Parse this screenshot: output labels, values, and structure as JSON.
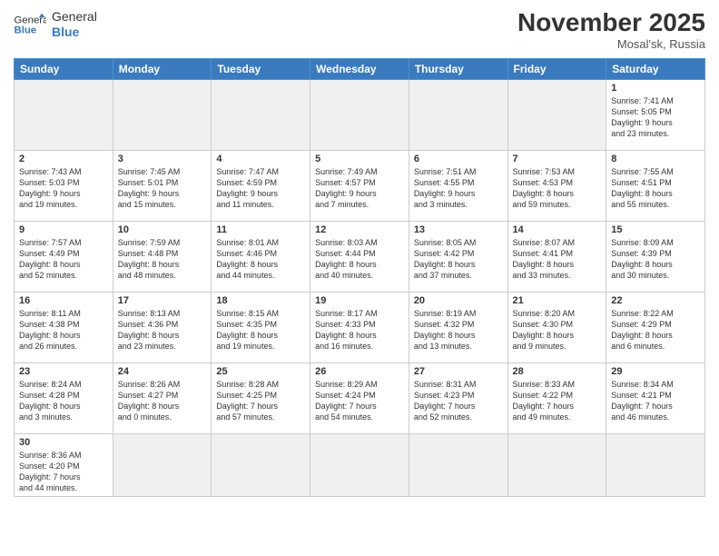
{
  "header": {
    "logo_general": "General",
    "logo_blue": "Blue",
    "month_title": "November 2025",
    "location": "Mosal'sk, Russia"
  },
  "weekdays": [
    "Sunday",
    "Monday",
    "Tuesday",
    "Wednesday",
    "Thursday",
    "Friday",
    "Saturday"
  ],
  "weeks": [
    [
      {
        "day": "",
        "info": "",
        "empty": true
      },
      {
        "day": "",
        "info": "",
        "empty": true
      },
      {
        "day": "",
        "info": "",
        "empty": true
      },
      {
        "day": "",
        "info": "",
        "empty": true
      },
      {
        "day": "",
        "info": "",
        "empty": true
      },
      {
        "day": "",
        "info": "",
        "empty": true
      },
      {
        "day": "1",
        "info": "Sunrise: 7:41 AM\nSunset: 5:05 PM\nDaylight: 9 hours\nand 23 minutes."
      }
    ],
    [
      {
        "day": "2",
        "info": "Sunrise: 7:43 AM\nSunset: 5:03 PM\nDaylight: 9 hours\nand 19 minutes."
      },
      {
        "day": "3",
        "info": "Sunrise: 7:45 AM\nSunset: 5:01 PM\nDaylight: 9 hours\nand 15 minutes."
      },
      {
        "day": "4",
        "info": "Sunrise: 7:47 AM\nSunset: 4:59 PM\nDaylight: 9 hours\nand 11 minutes."
      },
      {
        "day": "5",
        "info": "Sunrise: 7:49 AM\nSunset: 4:57 PM\nDaylight: 9 hours\nand 7 minutes."
      },
      {
        "day": "6",
        "info": "Sunrise: 7:51 AM\nSunset: 4:55 PM\nDaylight: 9 hours\nand 3 minutes."
      },
      {
        "day": "7",
        "info": "Sunrise: 7:53 AM\nSunset: 4:53 PM\nDaylight: 8 hours\nand 59 minutes."
      },
      {
        "day": "8",
        "info": "Sunrise: 7:55 AM\nSunset: 4:51 PM\nDaylight: 8 hours\nand 55 minutes."
      }
    ],
    [
      {
        "day": "9",
        "info": "Sunrise: 7:57 AM\nSunset: 4:49 PM\nDaylight: 8 hours\nand 52 minutes."
      },
      {
        "day": "10",
        "info": "Sunrise: 7:59 AM\nSunset: 4:48 PM\nDaylight: 8 hours\nand 48 minutes."
      },
      {
        "day": "11",
        "info": "Sunrise: 8:01 AM\nSunset: 4:46 PM\nDaylight: 8 hours\nand 44 minutes."
      },
      {
        "day": "12",
        "info": "Sunrise: 8:03 AM\nSunset: 4:44 PM\nDaylight: 8 hours\nand 40 minutes."
      },
      {
        "day": "13",
        "info": "Sunrise: 8:05 AM\nSunset: 4:42 PM\nDaylight: 8 hours\nand 37 minutes."
      },
      {
        "day": "14",
        "info": "Sunrise: 8:07 AM\nSunset: 4:41 PM\nDaylight: 8 hours\nand 33 minutes."
      },
      {
        "day": "15",
        "info": "Sunrise: 8:09 AM\nSunset: 4:39 PM\nDaylight: 8 hours\nand 30 minutes."
      }
    ],
    [
      {
        "day": "16",
        "info": "Sunrise: 8:11 AM\nSunset: 4:38 PM\nDaylight: 8 hours\nand 26 minutes."
      },
      {
        "day": "17",
        "info": "Sunrise: 8:13 AM\nSunset: 4:36 PM\nDaylight: 8 hours\nand 23 minutes."
      },
      {
        "day": "18",
        "info": "Sunrise: 8:15 AM\nSunset: 4:35 PM\nDaylight: 8 hours\nand 19 minutes."
      },
      {
        "day": "19",
        "info": "Sunrise: 8:17 AM\nSunset: 4:33 PM\nDaylight: 8 hours\nand 16 minutes."
      },
      {
        "day": "20",
        "info": "Sunrise: 8:19 AM\nSunset: 4:32 PM\nDaylight: 8 hours\nand 13 minutes."
      },
      {
        "day": "21",
        "info": "Sunrise: 8:20 AM\nSunset: 4:30 PM\nDaylight: 8 hours\nand 9 minutes."
      },
      {
        "day": "22",
        "info": "Sunrise: 8:22 AM\nSunset: 4:29 PM\nDaylight: 8 hours\nand 6 minutes."
      }
    ],
    [
      {
        "day": "23",
        "info": "Sunrise: 8:24 AM\nSunset: 4:28 PM\nDaylight: 8 hours\nand 3 minutes."
      },
      {
        "day": "24",
        "info": "Sunrise: 8:26 AM\nSunset: 4:27 PM\nDaylight: 8 hours\nand 0 minutes."
      },
      {
        "day": "25",
        "info": "Sunrise: 8:28 AM\nSunset: 4:25 PM\nDaylight: 7 hours\nand 57 minutes."
      },
      {
        "day": "26",
        "info": "Sunrise: 8:29 AM\nSunset: 4:24 PM\nDaylight: 7 hours\nand 54 minutes."
      },
      {
        "day": "27",
        "info": "Sunrise: 8:31 AM\nSunset: 4:23 PM\nDaylight: 7 hours\nand 52 minutes."
      },
      {
        "day": "28",
        "info": "Sunrise: 8:33 AM\nSunset: 4:22 PM\nDaylight: 7 hours\nand 49 minutes."
      },
      {
        "day": "29",
        "info": "Sunrise: 8:34 AM\nSunset: 4:21 PM\nDaylight: 7 hours\nand 46 minutes."
      }
    ],
    [
      {
        "day": "30",
        "info": "Sunrise: 8:36 AM\nSunset: 4:20 PM\nDaylight: 7 hours\nand 44 minutes."
      },
      {
        "day": "",
        "info": "",
        "empty": true
      },
      {
        "day": "",
        "info": "",
        "empty": true
      },
      {
        "day": "",
        "info": "",
        "empty": true
      },
      {
        "day": "",
        "info": "",
        "empty": true
      },
      {
        "day": "",
        "info": "",
        "empty": true
      },
      {
        "day": "",
        "info": "",
        "empty": true
      }
    ]
  ]
}
